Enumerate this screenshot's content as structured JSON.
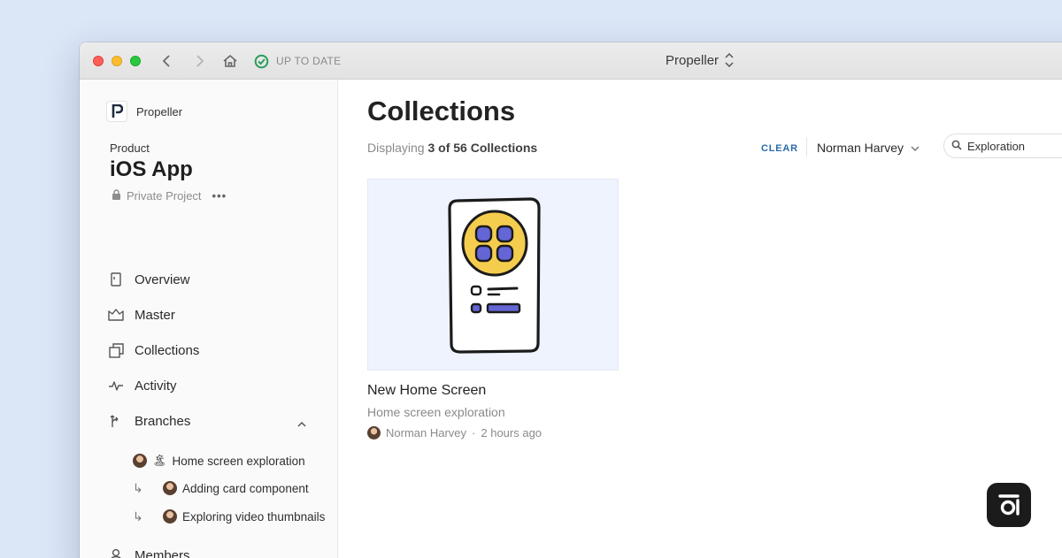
{
  "titlebar": {
    "sync_status": "UP TO DATE",
    "window_title": "Propeller"
  },
  "sidebar": {
    "org_name": "Propeller",
    "section_label": "Product",
    "project_title": "iOS App",
    "privacy_label": "Private Project",
    "more": "•••",
    "nav": [
      {
        "label": "Overview",
        "icon": "overview-icon"
      },
      {
        "label": "Master",
        "icon": "master-icon"
      },
      {
        "label": "Collections",
        "icon": "collections-icon"
      },
      {
        "label": "Activity",
        "icon": "activity-icon"
      },
      {
        "label": "Branches",
        "icon": "branches-icon"
      },
      {
        "label": "Members",
        "icon": "members-icon"
      }
    ],
    "branches": [
      {
        "label": "Home screen exploration",
        "emoji": "🏝",
        "sub": false
      },
      {
        "label": "Adding card component",
        "sub": true
      },
      {
        "label": "Exploring video thumbnails",
        "sub": true
      }
    ]
  },
  "main": {
    "title": "Collections",
    "displaying_prefix": "Displaying",
    "displaying_count": "3 of 56 Collections",
    "clear_label": "CLEAR",
    "filter_user": "Norman Harvey",
    "search_value": "Exploration",
    "cards": [
      {
        "title": "New Home Screen",
        "subtitle": "Home screen exploration",
        "author": "Norman Harvey",
        "separator": "·",
        "time": "2 hours ago"
      }
    ]
  },
  "colors": {
    "background": "#dbe6f7",
    "accent": "#2c6aa6",
    "thumbnail_bg": "#eef3fd",
    "illustration_yellow": "#f5cd4e",
    "illustration_purple": "#6466d6"
  }
}
